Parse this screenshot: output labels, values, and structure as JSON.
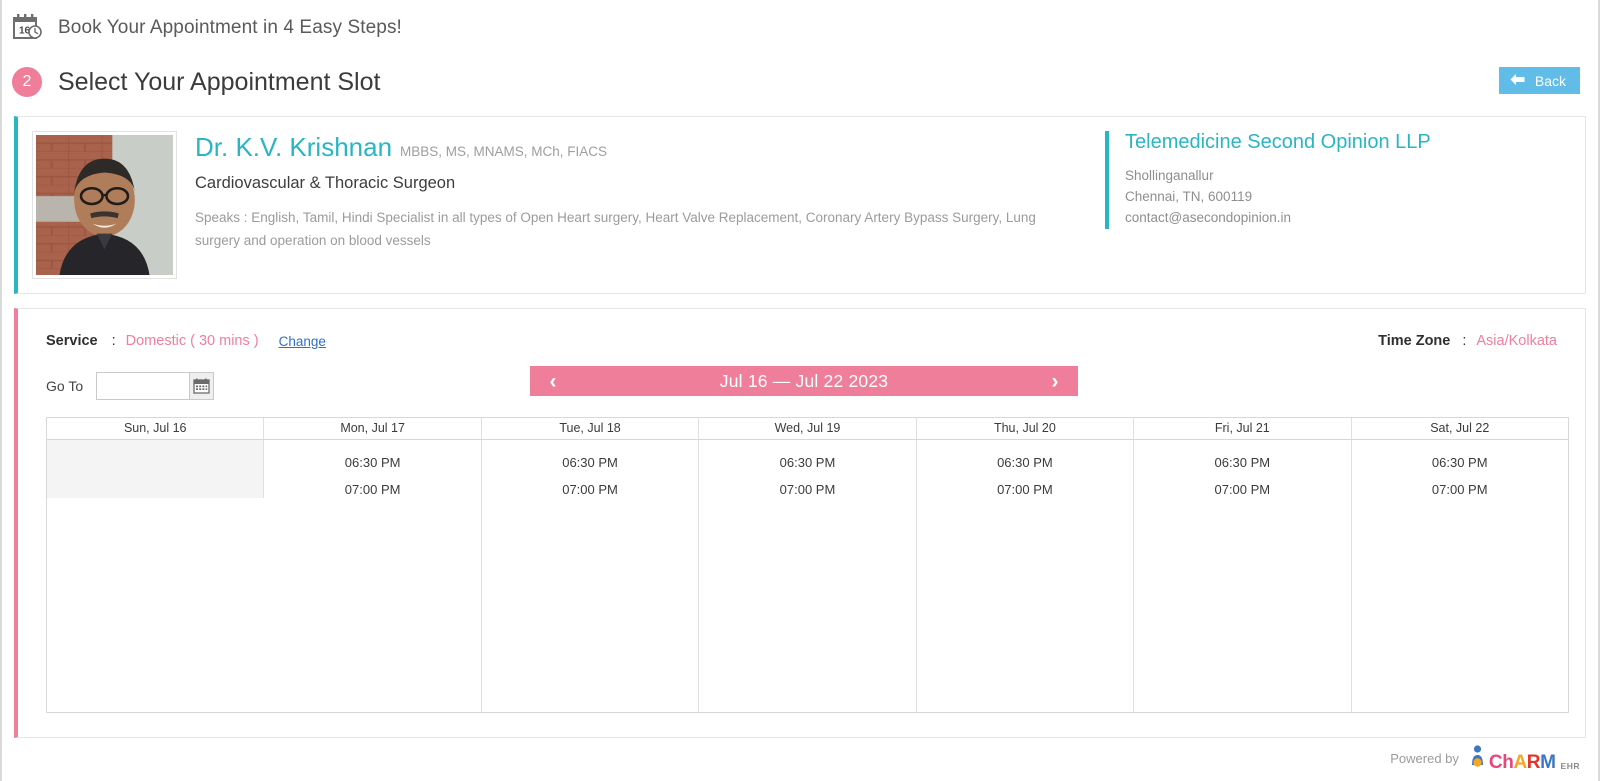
{
  "header": {
    "icon": "calendar-clock-icon",
    "calendar_day": "16",
    "title": "Book Your Appointment in 4 Easy Steps!"
  },
  "step": {
    "number": "2",
    "title": "Select Your Appointment Slot",
    "back_label": "Back",
    "back_icon": "arrow-left-icon",
    "accent_pink": "#ef7e9b",
    "back_blue": "#62bce8"
  },
  "doctor": {
    "name": "Dr. K.V. Krishnan",
    "qualifications": "MBBS, MS, MNAMS, MCh, FIACS",
    "specialty": "Cardiovascular & Thoracic Surgeon",
    "about": "Speaks : English, Tamil, Hindi Specialist in all types of Open Heart surgery, Heart Valve Replacement, Coronary Artery Bypass Surgery, Lung surgery and operation on blood vessels",
    "photo_alt": "doctor-portrait",
    "accent_teal": "#29b6c4"
  },
  "clinic": {
    "name": "Telemedicine Second Opinion LLP",
    "address_line1": "Shollinganallur",
    "address_line2": "Chennai, TN, 600119",
    "email": "contact@asecondopinion.in"
  },
  "service": {
    "label": "Service",
    "colon": ":",
    "value": "Domestic ( 30 mins )",
    "change_label": "Change"
  },
  "timezone": {
    "label": "Time Zone",
    "colon": ":",
    "value": "Asia/Kolkata"
  },
  "goto": {
    "label": "Go To",
    "value": "",
    "placeholder": "",
    "calendar_icon": "calendar-picker-icon"
  },
  "week_nav": {
    "prev_icon": "chevron-left-icon",
    "next_icon": "chevron-right-icon",
    "prev_glyph": "‹",
    "next_glyph": "›",
    "label": "Jul 16 — Jul 22 2023"
  },
  "slots": {
    "columns": [
      {
        "header": "Sun, Jul 16",
        "times": [],
        "disabled": true
      },
      {
        "header": "Mon, Jul 17",
        "times": [
          "06:30 PM",
          "07:00 PM"
        ],
        "disabled": false
      },
      {
        "header": "Tue, Jul 18",
        "times": [
          "06:30 PM",
          "07:00 PM"
        ],
        "disabled": false
      },
      {
        "header": "Wed, Jul 19",
        "times": [
          "06:30 PM",
          "07:00 PM"
        ],
        "disabled": false
      },
      {
        "header": "Thu, Jul 20",
        "times": [
          "06:30 PM",
          "07:00 PM"
        ],
        "disabled": false
      },
      {
        "header": "Fri, Jul 21",
        "times": [
          "06:30 PM",
          "07:00 PM"
        ],
        "disabled": false
      },
      {
        "header": "Sat, Jul 22",
        "times": [
          "06:30 PM",
          "07:00 PM"
        ],
        "disabled": false
      }
    ]
  },
  "footer": {
    "powered_by": "Powered by",
    "logo_part1": "Ch",
    "logo_part2": "A",
    "logo_part3": "R",
    "logo_part4": "M",
    "logo_sub": "EHR"
  }
}
